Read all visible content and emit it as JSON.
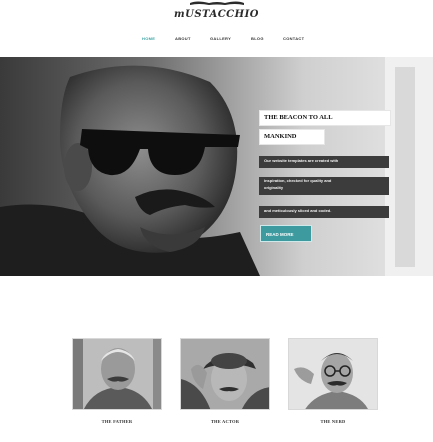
{
  "brand": {
    "logo_text": "mUSTACCHIO"
  },
  "nav": {
    "items": [
      {
        "label": "home",
        "active": true
      },
      {
        "label": "about",
        "active": false
      },
      {
        "label": "gallery",
        "active": false
      },
      {
        "label": "blog",
        "active": false
      },
      {
        "label": "contact",
        "active": false
      }
    ]
  },
  "hero": {
    "title_line1": "THE BEACON TO ALL",
    "title_line2": "MANKIND",
    "text_lines": [
      "Our website templates are created with",
      "inspiration, checked for quality and",
      "originality",
      "and meticulously sliced and coded."
    ],
    "button_label": "READ MORE"
  },
  "features": [
    {
      "caption": "THE FATHER"
    },
    {
      "caption": "THE ACTOR"
    },
    {
      "caption": "THE NERD"
    }
  ],
  "colors": {
    "accent": "#3d9a9f",
    "dark": "#3c3c3c"
  }
}
